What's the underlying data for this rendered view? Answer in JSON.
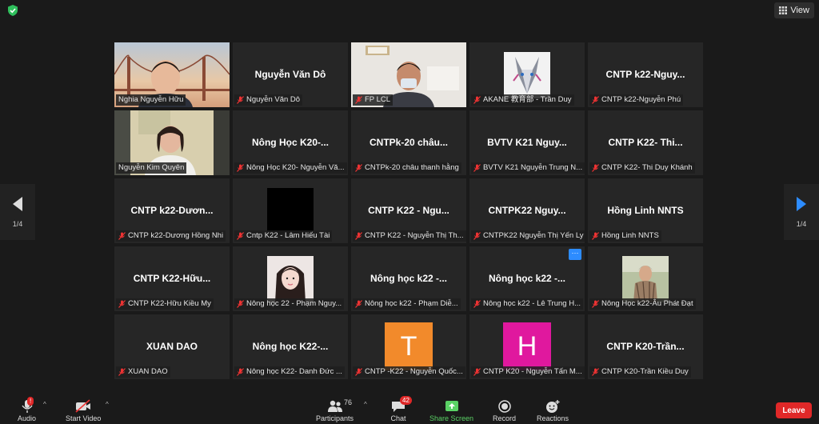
{
  "top": {
    "view_label": "View"
  },
  "pagination": {
    "left": "1/4",
    "right": "1/4"
  },
  "colors": {
    "active_speaker": "#d9ec6e",
    "share_green": "#5ad165",
    "leave_red": "#e02828",
    "avatar_t": "#f28a2b",
    "avatar_h": "#e0189e"
  },
  "tiles": [
    {
      "label": "Nghia Nguyễn Hữu",
      "muted": false,
      "kind": "video-bridge"
    },
    {
      "big": "Nguyễn Văn Dô",
      "label": "Nguyễn Văn Dô",
      "muted": true
    },
    {
      "label": "FP LCL",
      "muted": true,
      "kind": "video-man"
    },
    {
      "label": "AKANE 教育部 - Trần Duy",
      "muted": true,
      "kind": "wolf"
    },
    {
      "big": "CNTP  k22-Nguy...",
      "label": "CNTP k22-Nguyễn Phú",
      "muted": true
    },
    {
      "label": "Nguyễn Kim Quyên",
      "muted": false,
      "kind": "video-woman",
      "active": true
    },
    {
      "big": "Nông Học K20-...",
      "label": "Nông Học K20- Nguyễn Vă...",
      "muted": true
    },
    {
      "big": "CNTPk-20  châu...",
      "label": "CNTPk-20 châu thanh hằng",
      "muted": true
    },
    {
      "big": "BVTV K21  Nguy...",
      "label": "BVTV K21 Nguyễn Trung N...",
      "muted": true
    },
    {
      "big": "CNTP  K22- Thi...",
      "label": "CNTP K22- Thi Duy Khánh",
      "muted": true
    },
    {
      "big": "CNTP  k22-Dươn...",
      "label": "CNTP k22-Dương Hồng Nhi",
      "muted": true
    },
    {
      "label": "Cntp K22 - Lâm Hiếu Tài",
      "muted": true,
      "kind": "black"
    },
    {
      "big": "CNTP  K22  -  Ngu...",
      "label": "CNTP K22 - Nguyễn Thị Th...",
      "muted": true
    },
    {
      "big": "CNTPK22  Nguy...",
      "label": "CNTPK22 Nguyễn Thị Yến Ly",
      "muted": true
    },
    {
      "big": "Hồng Linh NNTS",
      "label": "Hồng Linh NNTS",
      "muted": true
    },
    {
      "big": "CNTP  K22-Hữu...",
      "label": "CNTP K22-Hữu Kiều My",
      "muted": true
    },
    {
      "label": "Nông học 22 - Phạm Nguy...",
      "muted": true,
      "kind": "girl"
    },
    {
      "big": "Nông học k22  -...",
      "label": "Nông học k22 - Phạm Diễ...",
      "muted": true
    },
    {
      "big": "Nông học k22  -...",
      "label": "Nông học k22 - Lê Trung H...",
      "muted": true,
      "more": "···"
    },
    {
      "label": "Nông Học k22-Âu Phát Đạt",
      "muted": true,
      "kind": "boy"
    },
    {
      "big": "XUAN DAO",
      "label": "XUAN DAO",
      "muted": true
    },
    {
      "big": "Nông học K22-...",
      "label": "Nông học K22- Danh Đức ...",
      "muted": true
    },
    {
      "label": "CNTP -K22 - Nguyễn Quốc...",
      "muted": true,
      "kind": "letter",
      "letter": "T",
      "color": "#f28a2b"
    },
    {
      "label": "CNTP K20 - Nguyễn Tấn M...",
      "muted": true,
      "kind": "letter",
      "letter": "H",
      "color": "#e0189e"
    },
    {
      "big": "CNTP  K20-Trần...",
      "label": "CNTP K20-Trần Kiều Duy",
      "muted": true
    }
  ],
  "toolbar": {
    "audio": "Audio",
    "audio_badge": "!",
    "start_video": "Start Video",
    "participants": "Participants",
    "participants_count": "76",
    "chat": "Chat",
    "chat_badge": "42",
    "share_screen": "Share Screen",
    "record": "Record",
    "reactions": "Reactions",
    "leave": "Leave"
  }
}
